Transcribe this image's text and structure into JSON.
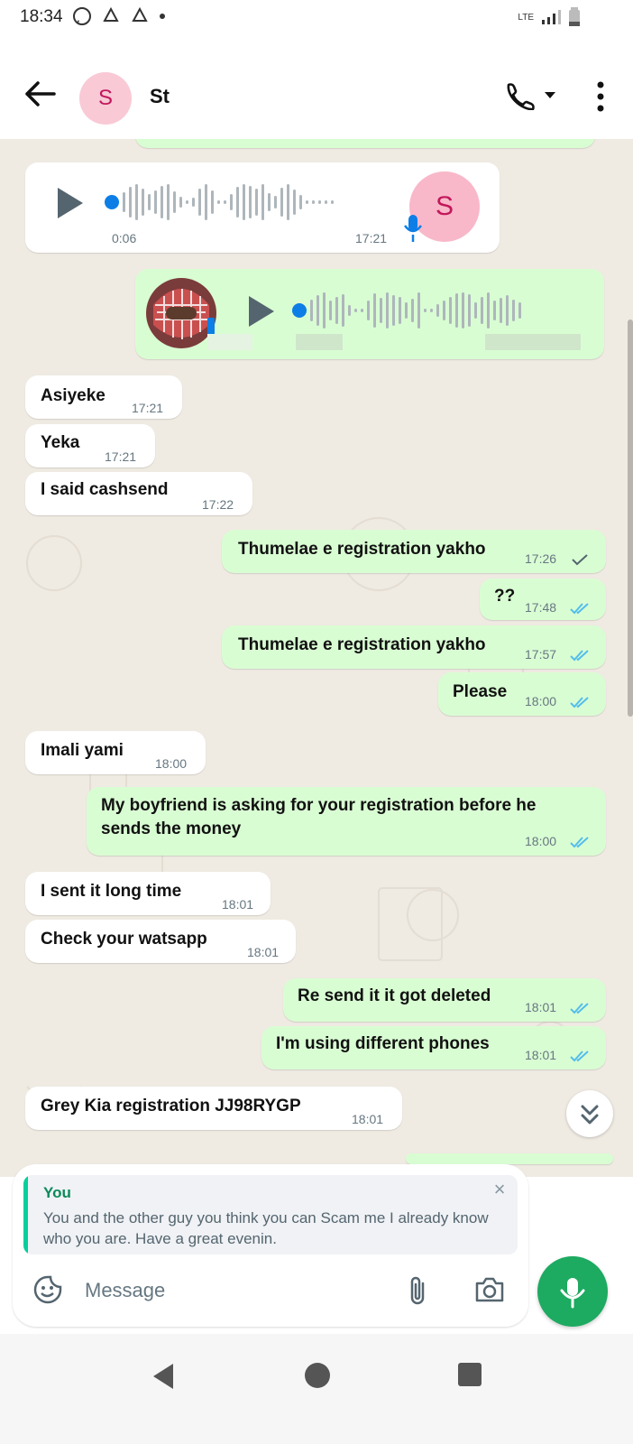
{
  "status_bar": {
    "time": "18:34",
    "network": "LTE"
  },
  "header": {
    "avatar_letter": "S",
    "contact_name": "St"
  },
  "voice_note_in": {
    "duration": "0:06",
    "time": "17:21",
    "avatar_letter": "S"
  },
  "messages": [
    {
      "dir": "in",
      "text": "Asiyeke",
      "time": "17:21"
    },
    {
      "dir": "in",
      "text": "Yeka",
      "time": "17:21"
    },
    {
      "dir": "in",
      "text": "I said cashsend",
      "time": "17:22"
    },
    {
      "dir": "out",
      "text": "Thumelae e registration yakho",
      "time": "17:26",
      "status": "sent"
    },
    {
      "dir": "out",
      "text": "??",
      "time": "17:48",
      "status": "read"
    },
    {
      "dir": "out",
      "text": "Thumelae e registration yakho",
      "time": "17:57",
      "status": "read"
    },
    {
      "dir": "out",
      "text": "Please",
      "time": "18:00",
      "status": "read"
    },
    {
      "dir": "in",
      "text": "Imali yami",
      "time": "18:00"
    },
    {
      "dir": "out",
      "text": "My boyfriend is asking for your registration before he",
      "text2": "sends the money",
      "time": "18:00",
      "status": "read"
    },
    {
      "dir": "in",
      "text": "I sent it long time",
      "time": "18:01"
    },
    {
      "dir": "in",
      "text": "Check your watsapp",
      "time": "18:01"
    },
    {
      "dir": "out",
      "text": "Re send it it got deleted",
      "time": "18:01",
      "status": "read"
    },
    {
      "dir": "out",
      "text": "I'm using different phones",
      "time": "18:01",
      "status": "read"
    },
    {
      "dir": "in",
      "text": "Grey Kia registration JJ98RYGP",
      "time": "18:01"
    }
  ],
  "reply_preview": {
    "author": "You",
    "text": "You and the other guy you think you can Scam me I already know who you are. Have a great evenin."
  },
  "composer": {
    "placeholder": "Message"
  },
  "colors": {
    "incoming": "#ffffff",
    "outgoing": "#d9fdd3",
    "read_tick": "#53bdeb",
    "accent": "#1daa61"
  }
}
